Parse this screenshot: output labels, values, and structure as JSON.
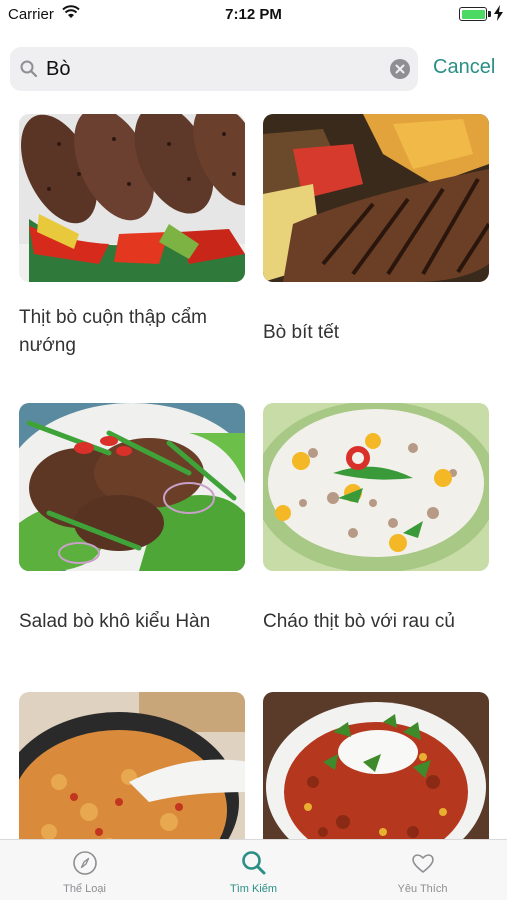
{
  "status_bar": {
    "carrier": "Carrier",
    "time": "7:12 PM",
    "battery_level": 1.0,
    "battery_color": "#4cd964"
  },
  "search": {
    "query": "Bò",
    "cancel_label": "Cancel",
    "accent_color": "#2a8f84"
  },
  "results": [
    {
      "title": "Thịt bò cuộn thập cẩm nướng",
      "image": "beef-rolls-with-vegetables"
    },
    {
      "title": "Bò bít tết",
      "image": "grilled-steak-with-potatoes"
    },
    {
      "title": "Salad bò khô kiểu Hàn",
      "image": "korean-beef-salad"
    },
    {
      "title": "Cháo thịt bò với rau củ",
      "image": "beef-congee-with-vegetables"
    },
    {
      "title": "",
      "image": "beef-rice-skillet"
    },
    {
      "title": "",
      "image": "beef-chili-soup"
    }
  ],
  "tab_bar": {
    "tabs": [
      {
        "label": "Thể Loại",
        "icon": "compass-icon",
        "active": false
      },
      {
        "label": "Tìm Kiếm",
        "icon": "search-icon",
        "active": true
      },
      {
        "label": "Yêu Thích",
        "icon": "heart-icon",
        "active": false
      }
    ]
  }
}
